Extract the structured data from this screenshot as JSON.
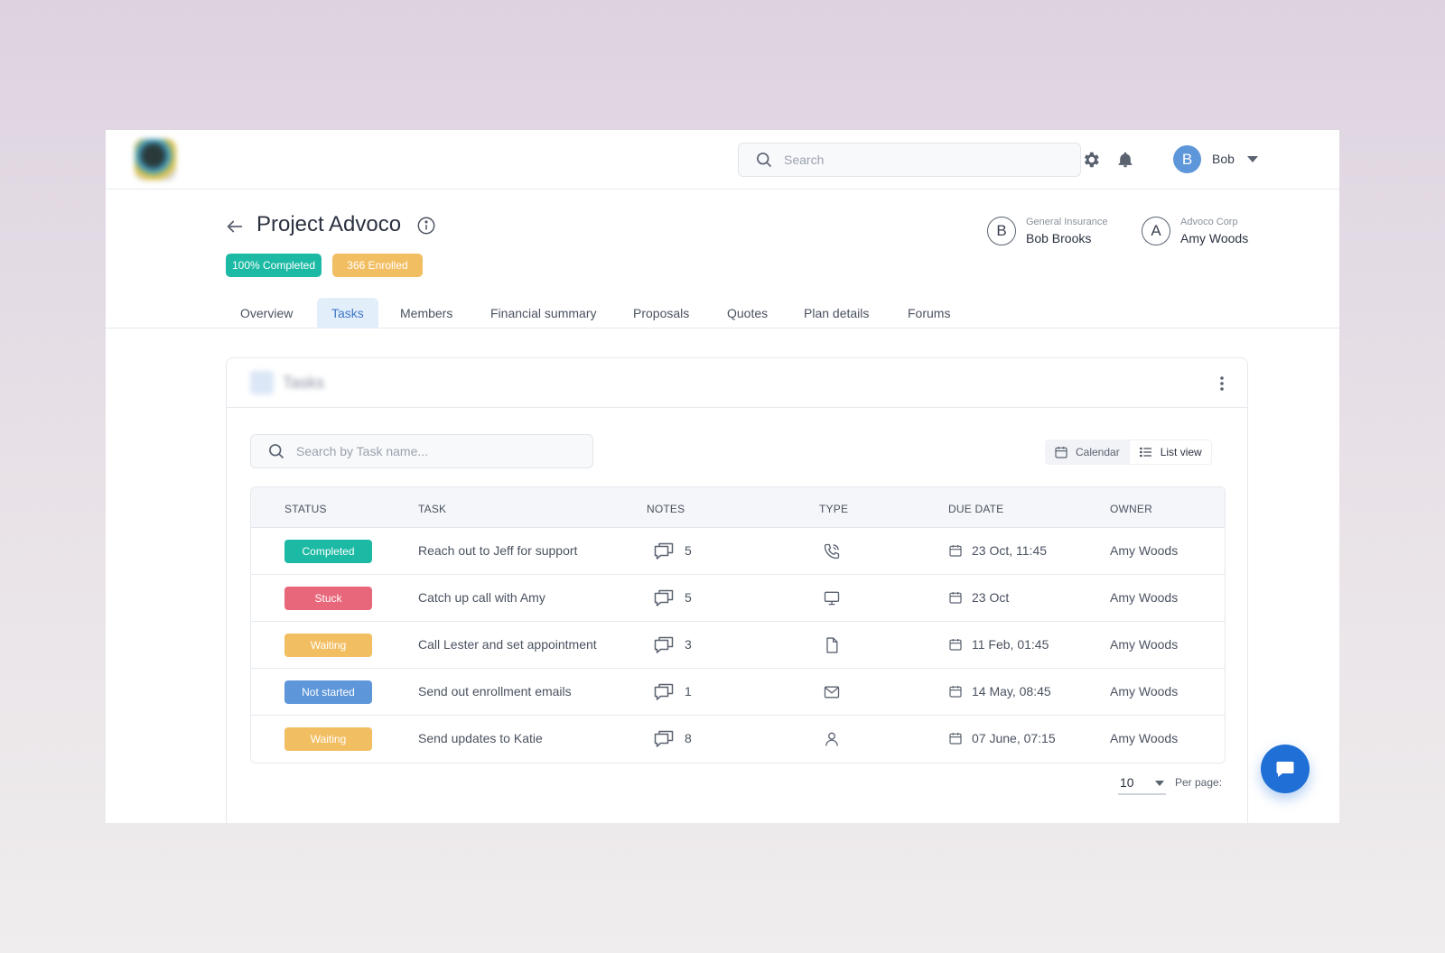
{
  "topbar": {
    "search_placeholder": "Search",
    "user": {
      "initial": "B",
      "name": "Bob"
    }
  },
  "project": {
    "title": "Project Advoco",
    "badges": {
      "completed": "100% Completed",
      "enrolled": "366 Enrolled"
    },
    "parties": [
      {
        "initial": "B",
        "org": "General Insurance",
        "name": "Bob Brooks"
      },
      {
        "initial": "A",
        "org": "Advoco Corp",
        "name": "Amy Woods"
      }
    ]
  },
  "tabs": [
    "Overview",
    "Tasks",
    "Members",
    "Financial summary",
    "Proposals",
    "Quotes",
    "Plan details",
    "Forums"
  ],
  "active_tab": "Tasks",
  "tasks_card": {
    "title": "Tasks",
    "search_placeholder": "Search by Task name...",
    "views": {
      "calendar": "Calendar",
      "list": "List view"
    },
    "columns": [
      "STATUS",
      "TASK",
      "NOTES",
      "TYPE",
      "DUE DATE",
      "OWNER"
    ],
    "rows": [
      {
        "status": "Completed",
        "task": "Reach out to Jeff for support",
        "notes": "5",
        "type": "phone-icon",
        "due": "23 Oct, 11:45",
        "owner": "Amy Woods"
      },
      {
        "status": "Stuck",
        "task": "Catch up call with Amy",
        "notes": "5",
        "type": "monitor-icon",
        "due": "23 Oct",
        "owner": "Amy Woods"
      },
      {
        "status": "Waiting",
        "task": "Call Lester and set appointment",
        "notes": "3",
        "type": "document-icon",
        "due": "11 Feb, 01:45",
        "owner": "Amy Woods"
      },
      {
        "status": "Not started",
        "task": "Send out enrollment emails",
        "notes": "1",
        "type": "mail-icon",
        "due": "14 May, 08:45",
        "owner": "Amy Woods"
      },
      {
        "status": "Waiting",
        "task": "Send updates to Katie",
        "notes": "8",
        "type": "person-icon",
        "due": "07 June, 07:15",
        "owner": "Amy Woods"
      }
    ],
    "per_page_value": "10",
    "per_page_label": "Per page:"
  },
  "colors": {
    "accent": "#3f78c6",
    "completed": "#1cbaa4",
    "stuck": "#e8677a",
    "waiting": "#f2be62",
    "not_started": "#5e97d9",
    "fab": "#1f6fd6"
  }
}
